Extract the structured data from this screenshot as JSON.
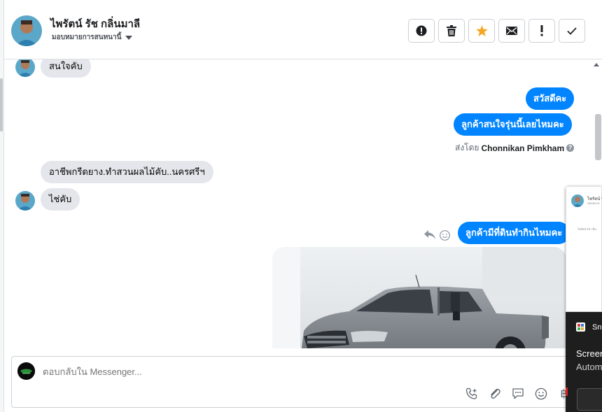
{
  "header": {
    "contact_name": "ไพรัตน์ รัช กลิ่นมาลี",
    "assign_label": "มอบหมายการสนทนานี้",
    "actions": [
      {
        "name": "spam-button",
        "icon": "alert-circle-icon"
      },
      {
        "name": "delete-button",
        "icon": "trash-icon"
      },
      {
        "name": "star-button",
        "icon": "star-icon"
      },
      {
        "name": "mark-unread-button",
        "icon": "envelope-icon"
      },
      {
        "name": "mark-important-button",
        "icon": "exclamation-icon"
      },
      {
        "name": "mark-done-button",
        "icon": "check-icon"
      }
    ]
  },
  "messages": [
    {
      "side": "in",
      "text": "สนใจคับ"
    },
    {
      "side": "out",
      "text": "สวัสดีคะ"
    },
    {
      "side": "out",
      "text": "ลูกค้าสนใจรุ่นนี้เลยไหมคะ"
    },
    {
      "side": "in",
      "text": "อาชีพกรีดยาง.ทำสวนผลไม้คับ..นครศรีฯ"
    },
    {
      "side": "in",
      "text": "ไช่คับ"
    },
    {
      "side": "out",
      "text": "ลูกค้ามีที่ดินทำกินไหมคะ"
    }
  ],
  "sent_by": {
    "prefix": "ส่งโดย",
    "name": "Chonnikan Pimkham",
    "help": "?"
  },
  "composer": {
    "placeholder": "ตอบกลับใน Messenger...",
    "baht": "฿"
  },
  "overlay": {
    "mini_name": "ไพรัตน์ รัช",
    "mini_sub": "มอบหมาย",
    "mini_text": "ไพรัตน์ รัช กลิ่น",
    "app_label": "Sn",
    "line1": "Screen",
    "line2": "Autom"
  },
  "colors": {
    "accent": "#0084ff",
    "star": "#f5a623",
    "bubble_in": "#e4e6eb"
  }
}
